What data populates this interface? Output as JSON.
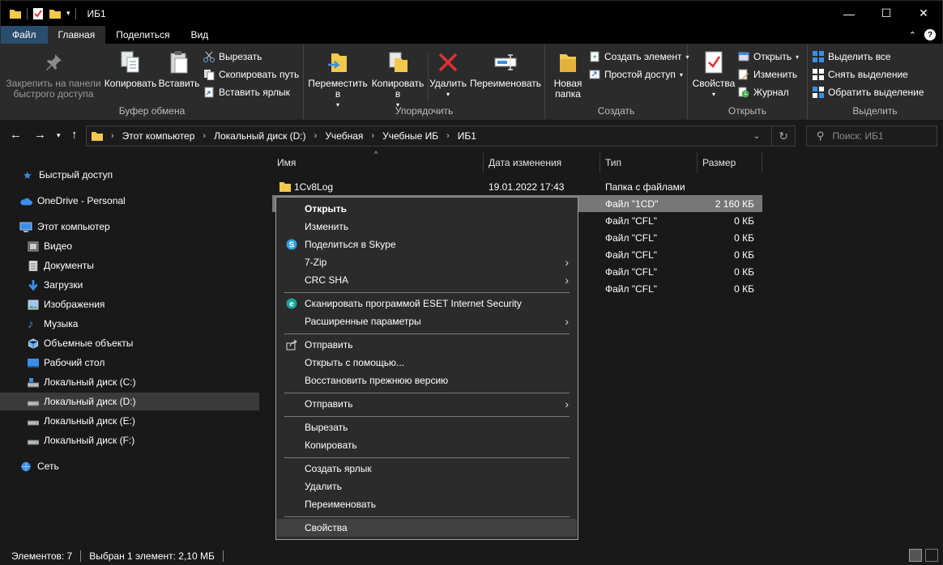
{
  "window": {
    "title": "ИБ1",
    "minimize": "—",
    "maximize": "☐",
    "close": "✕"
  },
  "tabs": {
    "file": "Файл",
    "home": "Главная",
    "share": "Поделиться",
    "view": "Вид"
  },
  "ribbon": {
    "clipboard": {
      "label": "Буфер обмена",
      "pin": "Закрепить на панели быстрого доступа",
      "copy": "Копировать",
      "paste": "Вставить",
      "cut": "Вырезать",
      "copy_path": "Скопировать путь",
      "paste_shortcut": "Вставить ярлык"
    },
    "organize": {
      "label": "Упорядочить",
      "move_to": "Переместить в",
      "copy_to": "Копировать в",
      "delete": "Удалить",
      "rename": "Переименовать"
    },
    "create": {
      "label": "Создать",
      "new_folder": "Новая папка",
      "new_item": "Создать элемент",
      "easy_access": "Простой доступ"
    },
    "open": {
      "label": "Открыть",
      "properties": "Свойства",
      "open": "Открыть",
      "edit": "Изменить",
      "history": "Журнал"
    },
    "select": {
      "label": "Выделить",
      "select_all": "Выделить все",
      "select_none": "Снять выделение",
      "invert": "Обратить выделение"
    }
  },
  "address": {
    "crumbs": [
      "Этот компьютер",
      "Локальный диск (D:)",
      "Учебная",
      "Учебные ИБ",
      "ИБ1"
    ],
    "search_placeholder": "Поиск: ИБ1"
  },
  "nav": {
    "quick_access": "Быстрый доступ",
    "onedrive": "OneDrive - Personal",
    "this_pc": "Этот компьютер",
    "video": "Видео",
    "documents": "Документы",
    "downloads": "Загрузки",
    "pictures": "Изображения",
    "music": "Музыка",
    "objects3d": "Объемные объекты",
    "desktop": "Рабочий стол",
    "disk_c": "Локальный диск (C:)",
    "disk_d": "Локальный диск (D:)",
    "disk_e": "Локальный диск (E:)",
    "disk_f": "Локальный диск (F:)",
    "network": "Сеть"
  },
  "columns": {
    "name": "Имя",
    "date": "Дата изменения",
    "type": "Тип",
    "size": "Размер"
  },
  "files": [
    {
      "name": "1Cv8Log",
      "date": "19.01.2022 17:43",
      "type": "Папка с файлами",
      "size": ""
    },
    {
      "name": "",
      "date": "",
      "type": "Файл \"1CD\"",
      "size": "2 160 КБ"
    },
    {
      "name": "",
      "date": "",
      "type": "Файл \"CFL\"",
      "size": "0 КБ"
    },
    {
      "name": "",
      "date": "",
      "type": "Файл \"CFL\"",
      "size": "0 КБ"
    },
    {
      "name": "",
      "date": "",
      "type": "Файл \"CFL\"",
      "size": "0 КБ"
    },
    {
      "name": "",
      "date": "",
      "type": "Файл \"CFL\"",
      "size": "0 КБ"
    },
    {
      "name": "",
      "date": "",
      "type": "Файл \"CFL\"",
      "size": "0 КБ"
    }
  ],
  "context_menu": {
    "open": "Открыть",
    "edit": "Изменить",
    "skype": "Поделиться в Skype",
    "zip": "7-Zip",
    "crc": "CRC SHA",
    "eset": "Сканировать программой ESET Internet Security",
    "advanced": "Расширенные параметры",
    "share": "Отправить",
    "open_with": "Открыть с помощью...",
    "restore": "Восстановить прежнюю версию",
    "send_to": "Отправить",
    "cut": "Вырезать",
    "copy": "Копировать",
    "shortcut": "Создать ярлык",
    "delete": "Удалить",
    "rename": "Переименовать",
    "properties": "Свойства"
  },
  "status": {
    "count": "Элементов: 7",
    "selected": "Выбран 1 элемент: 2,10 МБ"
  }
}
